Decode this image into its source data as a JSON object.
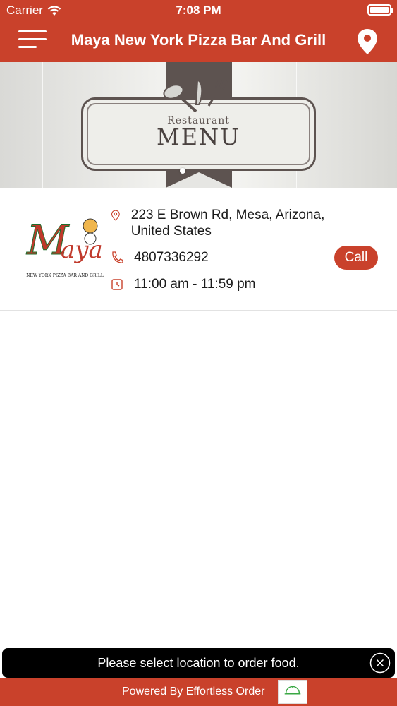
{
  "status_bar": {
    "carrier": "Carrier",
    "time": "7:08 PM"
  },
  "nav": {
    "title": "Maya New York Pizza Bar And Grill",
    "menu_icon": "hamburger-menu-icon",
    "location_icon": "location-pin-icon"
  },
  "banner": {
    "small_text": "Restaurant",
    "big_text": "MENU"
  },
  "restaurant": {
    "logo_text": "Maya",
    "logo_subtext": "NEW YORK PIZZA BAR AND GRILL",
    "address": "223 E Brown Rd, Mesa, Arizona, United States",
    "phone": "4807336292",
    "call_label": "Call",
    "hours": "11:00 am - 11:59 pm"
  },
  "toast": {
    "message": "Please select location to order food."
  },
  "footer": {
    "powered_by": "Powered By Effortless Order"
  },
  "colors": {
    "brand": "#c9412b",
    "toast_bg": "#000000"
  }
}
